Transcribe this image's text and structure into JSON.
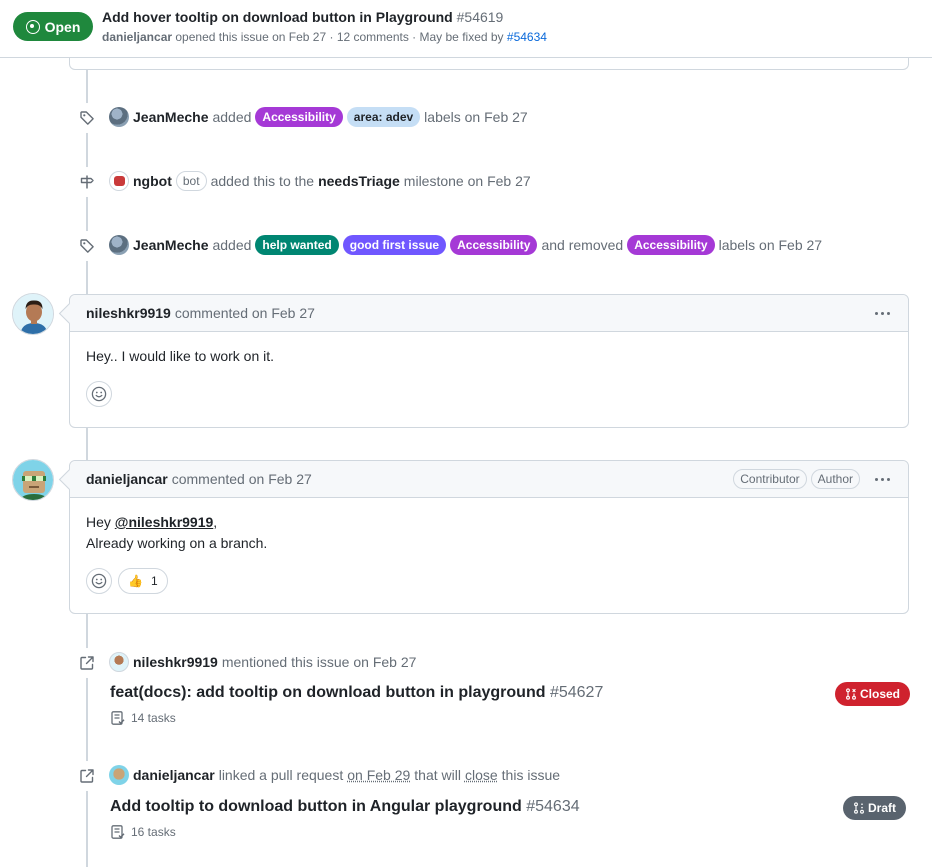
{
  "header": {
    "state": "Open",
    "title": "Add hover tooltip on download button in Playground",
    "number": "#54619",
    "author": "danieljancar",
    "meta_text": "opened this issue on Feb 27 · 12 comments · May be fixed by",
    "fixed_by": "#54634"
  },
  "events": [
    {
      "actor": "JeanMeche",
      "verb": "added",
      "labels": [
        {
          "text": "Accessibility",
          "color": "#a539d6"
        },
        {
          "text": "area: adev",
          "color": "#c5def5"
        }
      ],
      "suffix": "labels on Feb 27"
    },
    {
      "actor": "ngbot",
      "badge": "bot",
      "text": "added this to the",
      "milestone": "needsTriage",
      "suffix": "milestone on Feb 27"
    },
    {
      "actor": "JeanMeche",
      "verb": "added",
      "labels": [
        {
          "text": "help wanted",
          "color": "#008672"
        },
        {
          "text": "good first issue",
          "color": "#7057ff"
        },
        {
          "text": "Accessibility",
          "color": "#a539d6"
        }
      ],
      "removed_text": "and removed",
      "removed_label": {
        "text": "Accessibility",
        "color": "#a539d6"
      },
      "suffix": "labels on Feb 27"
    }
  ],
  "comments": [
    {
      "author": "nileshkr9919",
      "meta": "commented on Feb 27",
      "body_line1": "Hey.. I would like to work on it."
    },
    {
      "author": "danieljancar",
      "meta": "commented on Feb 27",
      "badges": [
        "Contributor",
        "Author"
      ],
      "body_greeting": "Hey",
      "body_mention": "@nileshkr9919",
      "body_comma": ",",
      "body_line2": "Already working on a branch.",
      "reaction_emoji": "👍",
      "reaction_count": "1"
    }
  ],
  "crossrefs": [
    {
      "actor": "nileshkr9919",
      "text": "mentioned this issue on Feb 27",
      "title": "feat(docs): add tooltip on download button in playground",
      "number": "#54627",
      "tasks": "14 tasks",
      "state": "Closed",
      "state_color": "#cf222e"
    },
    {
      "actor": "danieljancar",
      "text_pre": "linked a pull request",
      "date": "on Feb 29",
      "text_mid": "that will",
      "close_word": "close",
      "text_post": "this issue",
      "title": "Add tooltip to download button in Angular playground",
      "number": "#54634",
      "tasks": "16 tasks",
      "state": "Draft",
      "state_color": "#59636e"
    }
  ]
}
